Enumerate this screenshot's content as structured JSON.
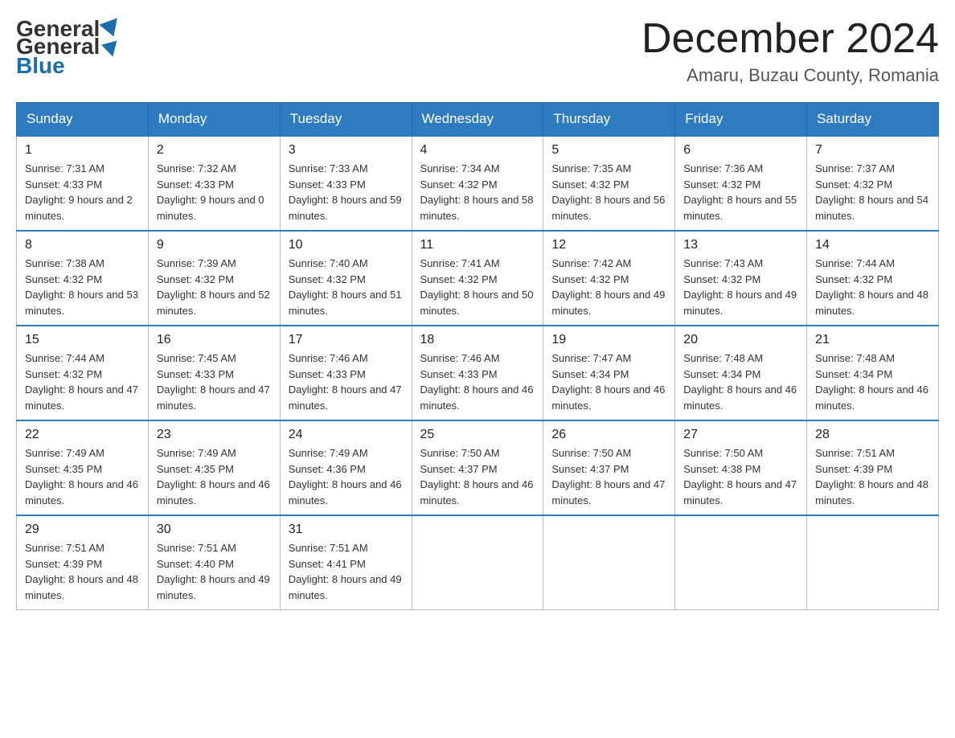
{
  "header": {
    "logo": {
      "general_text": "General",
      "blue_text": "Blue"
    },
    "title": "December 2024",
    "location": "Amaru, Buzau County, Romania"
  },
  "calendar": {
    "days_of_week": [
      "Sunday",
      "Monday",
      "Tuesday",
      "Wednesday",
      "Thursday",
      "Friday",
      "Saturday"
    ],
    "weeks": [
      [
        {
          "day": "1",
          "sunrise": "7:31 AM",
          "sunset": "4:33 PM",
          "daylight": "9 hours and 2 minutes."
        },
        {
          "day": "2",
          "sunrise": "7:32 AM",
          "sunset": "4:33 PM",
          "daylight": "9 hours and 0 minutes."
        },
        {
          "day": "3",
          "sunrise": "7:33 AM",
          "sunset": "4:33 PM",
          "daylight": "8 hours and 59 minutes."
        },
        {
          "day": "4",
          "sunrise": "7:34 AM",
          "sunset": "4:32 PM",
          "daylight": "8 hours and 58 minutes."
        },
        {
          "day": "5",
          "sunrise": "7:35 AM",
          "sunset": "4:32 PM",
          "daylight": "8 hours and 56 minutes."
        },
        {
          "day": "6",
          "sunrise": "7:36 AM",
          "sunset": "4:32 PM",
          "daylight": "8 hours and 55 minutes."
        },
        {
          "day": "7",
          "sunrise": "7:37 AM",
          "sunset": "4:32 PM",
          "daylight": "8 hours and 54 minutes."
        }
      ],
      [
        {
          "day": "8",
          "sunrise": "7:38 AM",
          "sunset": "4:32 PM",
          "daylight": "8 hours and 53 minutes."
        },
        {
          "day": "9",
          "sunrise": "7:39 AM",
          "sunset": "4:32 PM",
          "daylight": "8 hours and 52 minutes."
        },
        {
          "day": "10",
          "sunrise": "7:40 AM",
          "sunset": "4:32 PM",
          "daylight": "8 hours and 51 minutes."
        },
        {
          "day": "11",
          "sunrise": "7:41 AM",
          "sunset": "4:32 PM",
          "daylight": "8 hours and 50 minutes."
        },
        {
          "day": "12",
          "sunrise": "7:42 AM",
          "sunset": "4:32 PM",
          "daylight": "8 hours and 49 minutes."
        },
        {
          "day": "13",
          "sunrise": "7:43 AM",
          "sunset": "4:32 PM",
          "daylight": "8 hours and 49 minutes."
        },
        {
          "day": "14",
          "sunrise": "7:44 AM",
          "sunset": "4:32 PM",
          "daylight": "8 hours and 48 minutes."
        }
      ],
      [
        {
          "day": "15",
          "sunrise": "7:44 AM",
          "sunset": "4:32 PM",
          "daylight": "8 hours and 47 minutes."
        },
        {
          "day": "16",
          "sunrise": "7:45 AM",
          "sunset": "4:33 PM",
          "daylight": "8 hours and 47 minutes."
        },
        {
          "day": "17",
          "sunrise": "7:46 AM",
          "sunset": "4:33 PM",
          "daylight": "8 hours and 47 minutes."
        },
        {
          "day": "18",
          "sunrise": "7:46 AM",
          "sunset": "4:33 PM",
          "daylight": "8 hours and 46 minutes."
        },
        {
          "day": "19",
          "sunrise": "7:47 AM",
          "sunset": "4:34 PM",
          "daylight": "8 hours and 46 minutes."
        },
        {
          "day": "20",
          "sunrise": "7:48 AM",
          "sunset": "4:34 PM",
          "daylight": "8 hours and 46 minutes."
        },
        {
          "day": "21",
          "sunrise": "7:48 AM",
          "sunset": "4:34 PM",
          "daylight": "8 hours and 46 minutes."
        }
      ],
      [
        {
          "day": "22",
          "sunrise": "7:49 AM",
          "sunset": "4:35 PM",
          "daylight": "8 hours and 46 minutes."
        },
        {
          "day": "23",
          "sunrise": "7:49 AM",
          "sunset": "4:35 PM",
          "daylight": "8 hours and 46 minutes."
        },
        {
          "day": "24",
          "sunrise": "7:49 AM",
          "sunset": "4:36 PM",
          "daylight": "8 hours and 46 minutes."
        },
        {
          "day": "25",
          "sunrise": "7:50 AM",
          "sunset": "4:37 PM",
          "daylight": "8 hours and 46 minutes."
        },
        {
          "day": "26",
          "sunrise": "7:50 AM",
          "sunset": "4:37 PM",
          "daylight": "8 hours and 47 minutes."
        },
        {
          "day": "27",
          "sunrise": "7:50 AM",
          "sunset": "4:38 PM",
          "daylight": "8 hours and 47 minutes."
        },
        {
          "day": "28",
          "sunrise": "7:51 AM",
          "sunset": "4:39 PM",
          "daylight": "8 hours and 48 minutes."
        }
      ],
      [
        {
          "day": "29",
          "sunrise": "7:51 AM",
          "sunset": "4:39 PM",
          "daylight": "8 hours and 48 minutes."
        },
        {
          "day": "30",
          "sunrise": "7:51 AM",
          "sunset": "4:40 PM",
          "daylight": "8 hours and 49 minutes."
        },
        {
          "day": "31",
          "sunrise": "7:51 AM",
          "sunset": "4:41 PM",
          "daylight": "8 hours and 49 minutes."
        },
        null,
        null,
        null,
        null
      ]
    ]
  }
}
